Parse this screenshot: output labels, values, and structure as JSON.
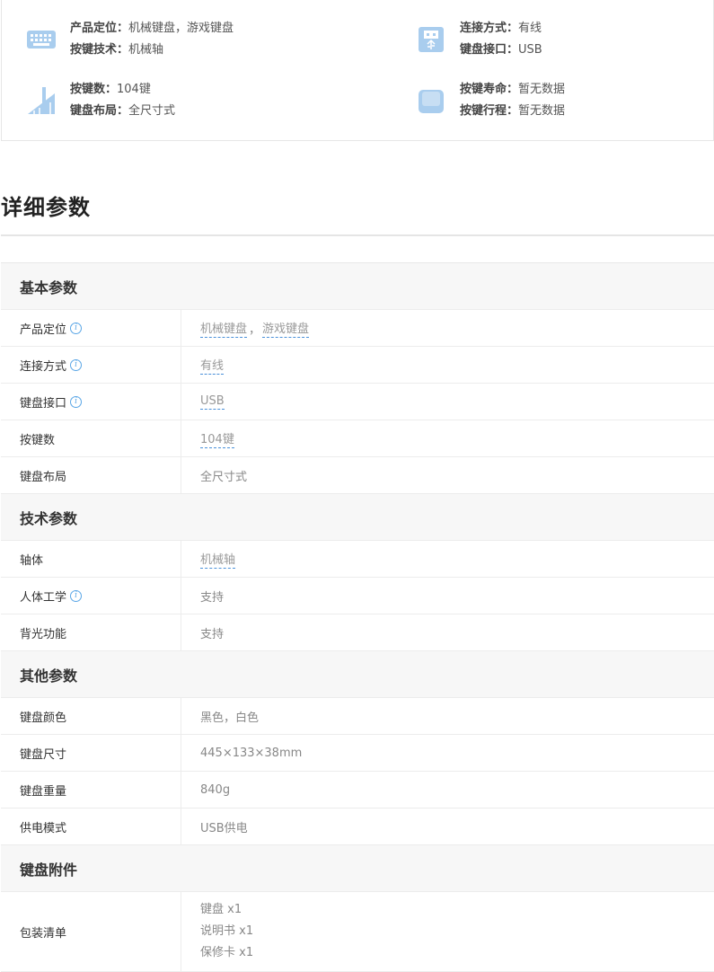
{
  "summary": [
    {
      "icon": "keyboard-icon",
      "lines": [
        {
          "k": "产品定位：",
          "v": "机械键盘，游戏键盘"
        },
        {
          "k": "按键技术：",
          "v": "机械轴"
        }
      ]
    },
    {
      "icon": "usb-icon",
      "lines": [
        {
          "k": "连接方式：",
          "v": "有线"
        },
        {
          "k": "键盘接口：",
          "v": "USB"
        }
      ]
    },
    {
      "icon": "ruler-icon",
      "lines": [
        {
          "k": "按键数：",
          "v": "104键"
        },
        {
          "k": "键盘布局：",
          "v": "全尺寸式"
        }
      ]
    },
    {
      "icon": "keycap-icon",
      "lines": [
        {
          "k": "按键寿命：",
          "v": "暂无数据"
        },
        {
          "k": "按键行程：",
          "v": "暂无数据"
        }
      ]
    }
  ],
  "section_title": "详细参数",
  "groups": [
    {
      "title": "基本参数",
      "rows": [
        {
          "name": "产品定位",
          "info": true,
          "value": "机械键盘",
          "value2": "游戏键盘",
          "sep": "，"
        },
        {
          "name": "连接方式",
          "info": true,
          "value": "有线"
        },
        {
          "name": "键盘接口",
          "info": true,
          "value": "USB"
        },
        {
          "name": "按键数",
          "value": "104键"
        },
        {
          "name": "键盘布局",
          "value": "全尺寸式"
        }
      ]
    },
    {
      "title": "技术参数",
      "rows": [
        {
          "name": "轴体",
          "value": "机械轴"
        },
        {
          "name": "人体工学",
          "info": true,
          "value": "支持"
        },
        {
          "name": "背光功能",
          "value": "支持"
        }
      ]
    },
    {
      "title": "其他参数",
      "rows": [
        {
          "name": "键盘颜色",
          "value": "黑色，白色"
        },
        {
          "name": "键盘尺寸",
          "value": "445×133×38mm"
        },
        {
          "name": "键盘重量",
          "value": "840g"
        },
        {
          "name": "供电模式",
          "value": "USB供电"
        }
      ]
    },
    {
      "title": "键盘附件",
      "rows": [
        {
          "name": "包装清单",
          "lines": [
            "键盘 x1",
            "说明书 x1",
            "保修卡 x1"
          ]
        }
      ]
    }
  ],
  "info_glyph": "i"
}
